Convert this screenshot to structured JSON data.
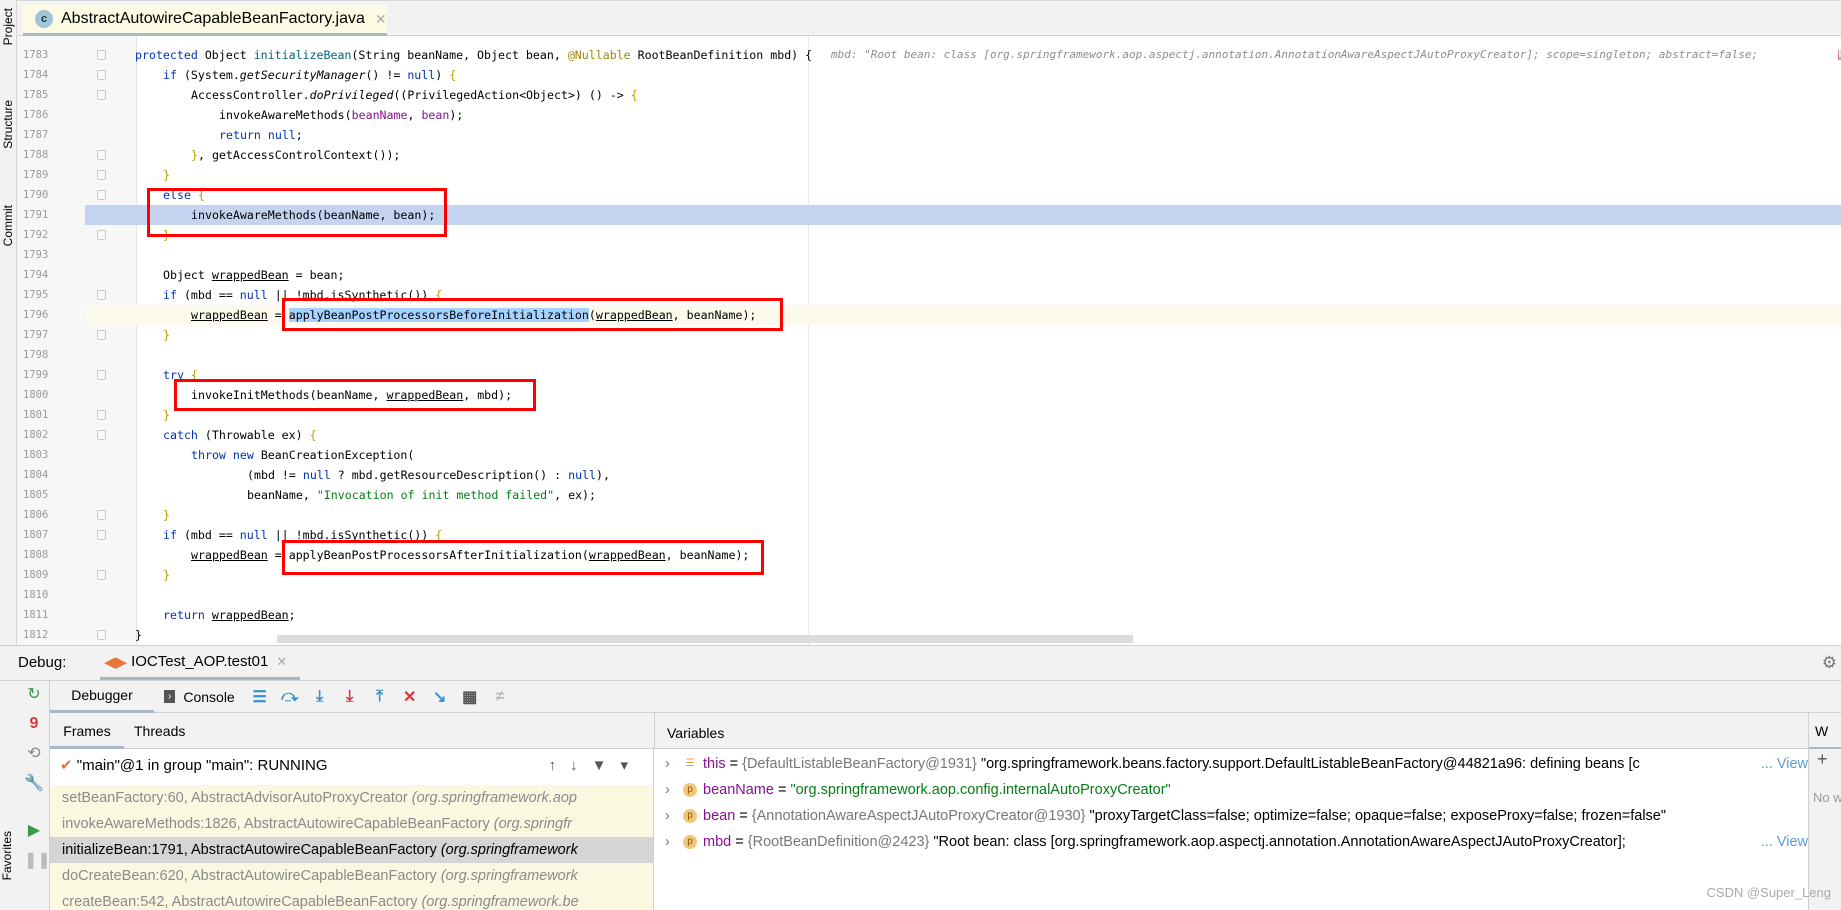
{
  "left_strip": {
    "items": [
      "Project",
      "Structure",
      "Commit"
    ]
  },
  "file_tab": {
    "name": "AbstractAutowireCapableBeanFactory.java",
    "icon": "c"
  },
  "editor": {
    "inline_hint": "mbd: \"Root bean: class [org.springframework.aop.aspectj.annotation.AnnotationAwareAspectJAutoProxyCreator]; scope=singleton; abstract=false;",
    "execution_line": 1791,
    "lines": [
      {
        "n": "1783",
        "ind": 1,
        "t": [
          [
            "protected ",
            "k"
          ],
          [
            "Object ",
            "t"
          ],
          [
            "initializeBean",
            "m"
          ],
          [
            "(String beanName, Object bean, ",
            "t"
          ],
          [
            "@Nullable",
            "a"
          ],
          [
            " RootBeanDefinition mbd) ",
            "t"
          ],
          [
            "{",
            "t"
          ]
        ]
      },
      {
        "n": "1784",
        "ind": 2,
        "t": [
          [
            "if ",
            "k"
          ],
          [
            "(System.",
            "t"
          ],
          [
            "getSecurityManager",
            "i"
          ],
          [
            "() != ",
            "t"
          ],
          [
            "null",
            "k"
          ],
          [
            ") ",
            "t"
          ],
          [
            "{",
            "y"
          ]
        ]
      },
      {
        "n": "1785",
        "ind": 3,
        "t": [
          [
            "AccessController.",
            "t"
          ],
          [
            "doPrivileged",
            "i"
          ],
          [
            "((PrivilegedAction<Object>) () -> ",
            "t"
          ],
          [
            "{",
            "y"
          ]
        ]
      },
      {
        "n": "1786",
        "ind": 4,
        "t": [
          [
            "invokeAwareMethods(",
            "t"
          ],
          [
            "beanName",
            "p"
          ],
          [
            ", ",
            "t"
          ],
          [
            "bean",
            "p"
          ],
          [
            ");",
            "t"
          ]
        ]
      },
      {
        "n": "1787",
        "ind": 4,
        "t": [
          [
            "return null",
            "k"
          ],
          [
            ";",
            "t"
          ]
        ]
      },
      {
        "n": "1788",
        "ind": 3,
        "t": [
          [
            "}",
            "y"
          ],
          [
            ", getAccessControlContext());",
            "t"
          ]
        ]
      },
      {
        "n": "1789",
        "ind": 2,
        "t": [
          [
            "}",
            "y"
          ]
        ]
      },
      {
        "n": "1790",
        "ind": 2,
        "t": [
          [
            "else ",
            "k"
          ],
          [
            "{",
            "y"
          ]
        ]
      },
      {
        "n": "1791",
        "ind": 3,
        "t": [
          [
            "invokeAwareMethods(beanName, bean);",
            "t"
          ]
        ]
      },
      {
        "n": "1792",
        "ind": 2,
        "t": [
          [
            "}",
            "y"
          ]
        ]
      },
      {
        "n": "1793",
        "ind": 0,
        "t": []
      },
      {
        "n": "1794",
        "ind": 2,
        "t": [
          [
            "Object ",
            "t"
          ],
          [
            "wrappedBean",
            "u"
          ],
          [
            " = bean;",
            "t"
          ]
        ]
      },
      {
        "n": "1795",
        "ind": 2,
        "t": [
          [
            "if ",
            "k"
          ],
          [
            "(mbd == ",
            "t"
          ],
          [
            "null",
            "k"
          ],
          [
            " || !mbd.isSynthetic()) ",
            "t"
          ],
          [
            "{",
            "y"
          ]
        ]
      },
      {
        "n": "1796",
        "ind": 3,
        "t": [
          [
            "wrappedBean",
            "u"
          ],
          [
            " = ",
            "t"
          ],
          [
            "applyBeanPostProcessorsBeforeInitialization",
            "sel"
          ],
          [
            "(",
            "t"
          ],
          [
            "wrappedBean",
            "u"
          ],
          [
            ", beanName);",
            "t"
          ]
        ]
      },
      {
        "n": "1797",
        "ind": 2,
        "t": [
          [
            "}",
            "y"
          ]
        ]
      },
      {
        "n": "1798",
        "ind": 0,
        "t": []
      },
      {
        "n": "1799",
        "ind": 2,
        "t": [
          [
            "try ",
            "k"
          ],
          [
            "{",
            "y"
          ]
        ]
      },
      {
        "n": "1800",
        "ind": 3,
        "t": [
          [
            "invokeInitMethods(beanName, ",
            "t"
          ],
          [
            "wrappedBean",
            "u"
          ],
          [
            ", mbd);",
            "t"
          ]
        ]
      },
      {
        "n": "1801",
        "ind": 2,
        "t": [
          [
            "}",
            "y"
          ]
        ]
      },
      {
        "n": "1802",
        "ind": 2,
        "t": [
          [
            "catch ",
            "k"
          ],
          [
            "(Throwable ex) ",
            "t"
          ],
          [
            "{",
            "y"
          ]
        ]
      },
      {
        "n": "1803",
        "ind": 3,
        "t": [
          [
            "throw new ",
            "k"
          ],
          [
            "BeanCreationException(",
            "t"
          ]
        ]
      },
      {
        "n": "1804",
        "ind": 5,
        "t": [
          [
            "(mbd != ",
            "t"
          ],
          [
            "null",
            "k"
          ],
          [
            " ? mbd.getResourceDescription() : ",
            "t"
          ],
          [
            "null",
            "k"
          ],
          [
            "),",
            "t"
          ]
        ]
      },
      {
        "n": "1805",
        "ind": 5,
        "t": [
          [
            "beanName, ",
            "t"
          ],
          [
            "\"Invocation of init method failed\"",
            "s"
          ],
          [
            ", ex);",
            "t"
          ]
        ]
      },
      {
        "n": "1806",
        "ind": 2,
        "t": [
          [
            "}",
            "y"
          ]
        ]
      },
      {
        "n": "1807",
        "ind": 2,
        "t": [
          [
            "if ",
            "k"
          ],
          [
            "(mbd == ",
            "t"
          ],
          [
            "null",
            "k"
          ],
          [
            " || !mbd.isSynthetic()) ",
            "t"
          ],
          [
            "{",
            "y"
          ]
        ]
      },
      {
        "n": "1808",
        "ind": 3,
        "t": [
          [
            "wrappedBean",
            "u"
          ],
          [
            " = applyBeanPostProcessorsAfterInitialization(",
            "t"
          ],
          [
            "wrappedBean",
            "u"
          ],
          [
            ", beanName);",
            "t"
          ]
        ]
      },
      {
        "n": "1809",
        "ind": 2,
        "t": [
          [
            "}",
            "y"
          ]
        ]
      },
      {
        "n": "1810",
        "ind": 0,
        "t": []
      },
      {
        "n": "1811",
        "ind": 2,
        "t": [
          [
            "return ",
            "k"
          ],
          [
            "wrappedBean",
            "u"
          ],
          [
            ";",
            "t"
          ]
        ]
      },
      {
        "n": "1812",
        "ind": 1,
        "t": [
          [
            "}",
            "t"
          ]
        ]
      }
    ]
  },
  "debug": {
    "label": "Debug:",
    "session": "IOCTest_AOP.test01",
    "tabs": {
      "debugger": "Debugger",
      "console": "Console"
    },
    "subtabs": {
      "frames": "Frames",
      "threads": "Threads"
    },
    "variables_label": "Variables",
    "watches_label": "W",
    "watches_empty": "No w",
    "thread": "\"main\"@1 in group \"main\": RUNNING",
    "frames": [
      {
        "method": "setBeanFactory:60, AbstractAdvisorAutoProxyCreator ",
        "pkg": "(org.springframework.aop",
        "current": false
      },
      {
        "method": "invokeAwareMethods:1826, AbstractAutowireCapableBeanFactory ",
        "pkg": "(org.springfr",
        "current": false
      },
      {
        "method": "initializeBean:1791, AbstractAutowireCapableBeanFactory ",
        "pkg": "(org.springframework",
        "current": true
      },
      {
        "method": "doCreateBean:620, AbstractAutowireCapableBeanFactory ",
        "pkg": "(org.springframework",
        "current": false
      },
      {
        "method": "createBean:542, AbstractAutowireCapableBeanFactory ",
        "pkg": "(org.springframework.be",
        "current": false
      }
    ],
    "variables": [
      {
        "icon": "field-list-icon",
        "name": "this",
        "type": "{DefaultListableBeanFactory@1931}",
        "value": "\"org.springframework.beans.factory.support.DefaultListableBeanFactory@44821a96: defining beans [c",
        "string": false,
        "view": "... View"
      },
      {
        "icon": "p",
        "name": "beanName",
        "type": "",
        "value": "\"org.springframework.aop.config.internalAutoProxyCreator\"",
        "string": true,
        "view": ""
      },
      {
        "icon": "p",
        "name": "bean",
        "type": "{AnnotationAwareAspectJAutoProxyCreator@1930}",
        "value": "\"proxyTargetClass=false; optimize=false; opaque=false; exposeProxy=false; frozen=false\"",
        "string": false,
        "view": ""
      },
      {
        "icon": "p",
        "name": "mbd",
        "type": "{RootBeanDefinition@2423}",
        "value": "\"Root bean: class [org.springframework.aop.aspectj.annotation.AnnotationAwareAspectJAutoProxyCreator];",
        "string": false,
        "view": "... View"
      }
    ],
    "badge_count": "9"
  },
  "watermark": "CSDN @Super_Leng",
  "colors": {
    "highlight_box": "#ff0000",
    "execution_line": "#c3d3f0",
    "selection": "#a6d2ff",
    "keyword": "#0033b3",
    "string": "#067d17"
  }
}
